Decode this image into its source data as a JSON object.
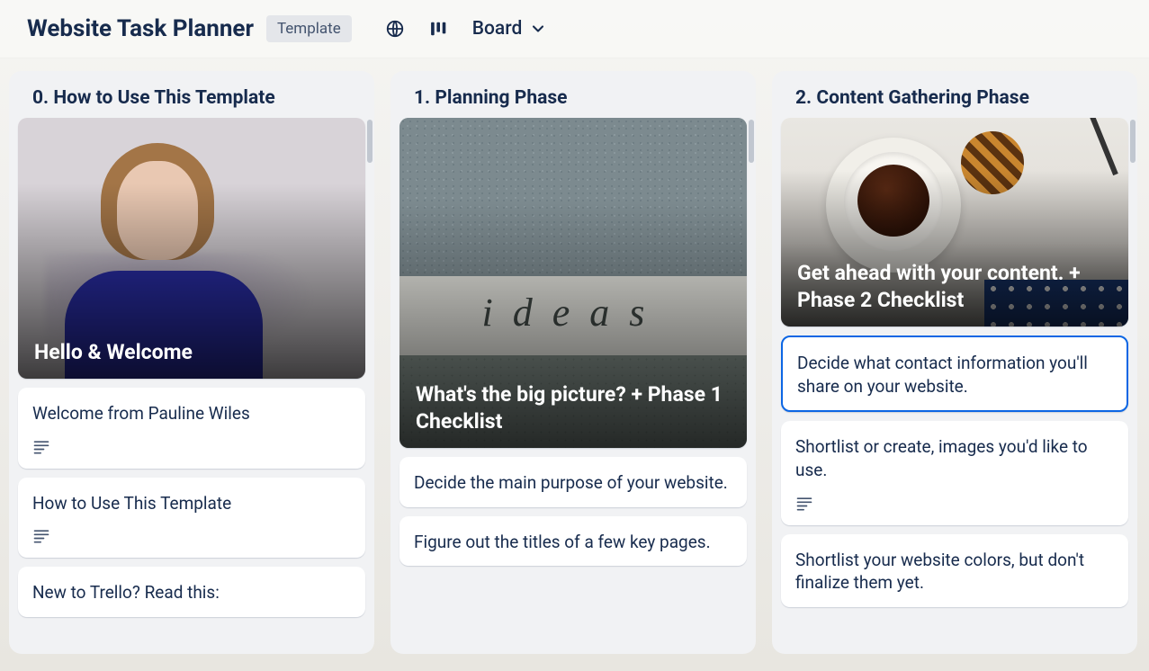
{
  "header": {
    "title": "Website Task Planner",
    "template_badge": "Template",
    "view_label": "Board"
  },
  "lists": [
    {
      "title": "0. How to Use This Template",
      "cover_card": {
        "title": "Hello & Welcome"
      },
      "cards": [
        {
          "text": "Welcome from Pauline Wiles",
          "has_description": true
        },
        {
          "text": "How to Use This Template",
          "has_description": true
        },
        {
          "text": "New to Trello? Read this:"
        }
      ]
    },
    {
      "title": "1. Planning Phase",
      "cover_card": {
        "title": "What's the big picture? + Phase 1 Checklist"
      },
      "cards": [
        {
          "text": "Decide the main purpose of your website."
        },
        {
          "text": "Figure out the titles of a few key pages."
        }
      ]
    },
    {
      "title": "2. Content Gathering Phase",
      "cover_card": {
        "title": "Get ahead with your content. + Phase 2 Checklist"
      },
      "cards": [
        {
          "text": "Decide what contact information you'll share on your website.",
          "selected": true
        },
        {
          "text": "Shortlist or create, images you'd like to use.",
          "has_description": true
        },
        {
          "text": "Shortlist your website colors, but don't finalize them yet."
        }
      ]
    }
  ]
}
